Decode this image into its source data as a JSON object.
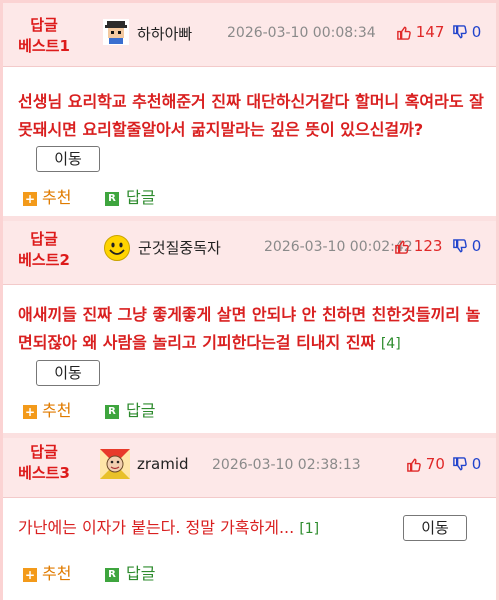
{
  "comments": [
    {
      "best_label_1": "답글",
      "best_label_2": "베스트1",
      "avatar_icon": "pixel-character-avatar",
      "nickname": "하하아빠",
      "date": "2026-03-10 00:08:34",
      "upvotes": "147",
      "downvotes": "0",
      "text": "선생님 요리학교 추천해준거 진짜 대단하신거같다 할머니 혹여라도 잘못돼시면 요리할줄알아서 굶지말라는 깊은 뜻이 있으신걸까?",
      "reply_count": "",
      "move_label": "이동",
      "recommend_label": "추천",
      "reply_label": "답글"
    },
    {
      "best_label_1": "답글",
      "best_label_2": "베스트2",
      "avatar_icon": "smiley-face-avatar",
      "nickname": "군것질중독자",
      "date": "2026-03-10 00:02:42",
      "upvotes": "123",
      "downvotes": "0",
      "text": "애새끼들 진짜 그냥 좋게좋게 살면 안되냐 안 친하면 친한것들끼리 놀면되잖아 왜 사람을 놀리고 기피한다는걸 티내지 진짜",
      "reply_count": "[4]",
      "move_label": "이동",
      "recommend_label": "추천",
      "reply_label": "답글"
    },
    {
      "best_label_1": "답글",
      "best_label_2": "베스트3",
      "avatar_icon": "character-face-avatar",
      "nickname": "zramid",
      "date": "2026-03-10 02:38:13",
      "upvotes": "70",
      "downvotes": "0",
      "text": "가난에는 이자가 붙는다. 정말 가혹하게...",
      "reply_count": "[1]",
      "move_label": "이동",
      "recommend_label": "추천",
      "reply_label": "답글"
    }
  ],
  "colors": {
    "header_bg": "#fde8e8",
    "border": "#fbd3d3",
    "best_text": "#dd1b1b",
    "upvote": "#e02828",
    "downvote": "#2244cc",
    "recommend": "#e07b00",
    "reply": "#2e8b2e"
  }
}
